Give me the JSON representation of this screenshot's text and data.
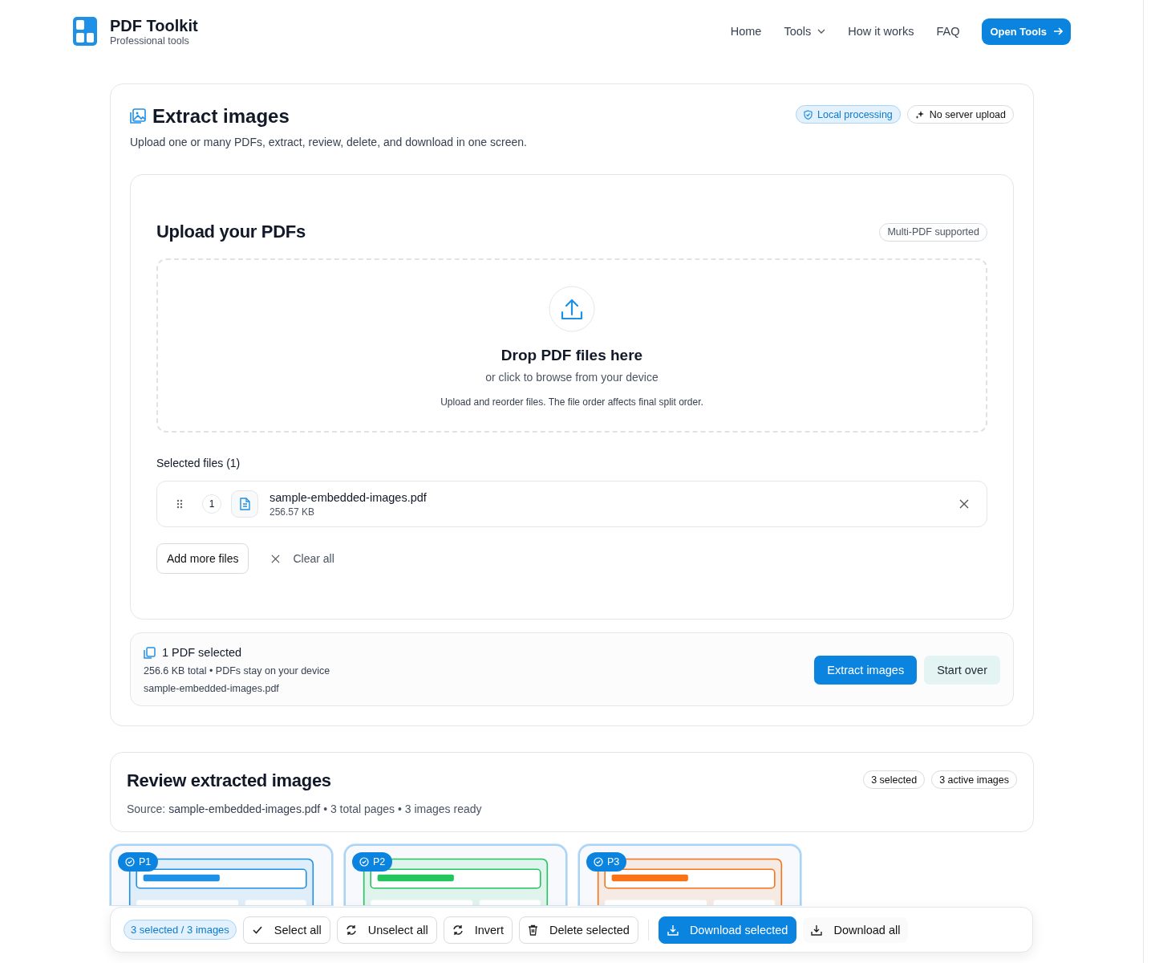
{
  "brand": {
    "name": "PDF Toolkit",
    "tagline": "Professional tools"
  },
  "nav": [
    {
      "label": "Home",
      "kind": "link"
    },
    {
      "label": "Tools",
      "kind": "dropdown"
    },
    {
      "label": "How it works",
      "kind": "link"
    },
    {
      "label": "FAQ",
      "kind": "link"
    }
  ],
  "nav_button": "Open Tools",
  "tool": {
    "title": "Extract images",
    "subtitle": "Upload one or many PDFs, extract, review, delete, and download in one screen.",
    "badges": [
      {
        "label": "Local processing",
        "kind": "shield"
      },
      {
        "label": "No server upload",
        "kind": "sparkle"
      }
    ]
  },
  "upload": {
    "title": "Upload your PDFs",
    "badge": "Multi-PDF supported",
    "drop_title": "Drop PDF files here",
    "drop_subtitle": "or click to browse from your device",
    "drop_hint": "Upload and reorder files. The file order affects final split order.",
    "files_heading": "Selected files (1)",
    "files": [
      {
        "index": "1",
        "name": "sample-embedded-images.pdf",
        "size": "256.57 KB"
      }
    ],
    "add_button": "Add more files",
    "clear_button": "Clear all"
  },
  "summary": {
    "title": "1 PDF selected",
    "details": "256.6 KB total • PDFs stay on your device",
    "file": "sample-embedded-images.pdf",
    "primary_button": "Extract images",
    "secondary_button": "Start over"
  },
  "review": {
    "title": "Review extracted images",
    "source_label": "Source:",
    "source_file": "sample-embedded-images.pdf",
    "stats": "• 3 total pages • 3 images ready",
    "badges": [
      "3 selected",
      "3 active images"
    ]
  },
  "images": [
    {
      "page": "P1",
      "selected": true,
      "color": "#1e90e6"
    },
    {
      "page": "P2",
      "selected": true,
      "color": "#22c55e"
    },
    {
      "page": "P3",
      "selected": true,
      "color": "#f97316"
    }
  ],
  "toolbar": {
    "count": "3 selected / 3 images",
    "buttons": [
      {
        "label": "Select all",
        "kind": "check"
      },
      {
        "label": "Unselect all",
        "kind": "refresh"
      },
      {
        "label": "Invert",
        "kind": "refresh"
      },
      {
        "label": "Delete selected",
        "kind": "trash"
      },
      {
        "label": "Download selected",
        "kind": "download-primary"
      },
      {
        "label": "Download all",
        "kind": "download"
      }
    ]
  }
}
